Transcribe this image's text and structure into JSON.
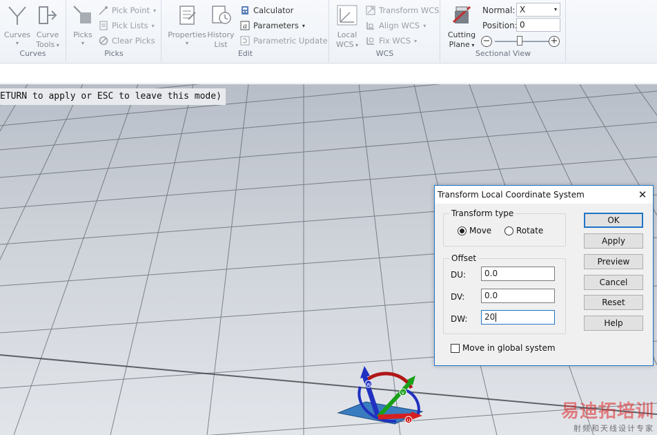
{
  "ribbon": {
    "curves_group": {
      "label": "Curves",
      "curves_button": "Curves",
      "curve_tools_button_line1": "Curve",
      "curve_tools_button_line2": "Tools"
    },
    "picks_group": {
      "label": "Picks",
      "picks_button": "Picks",
      "pick_point": "Pick Point",
      "pick_lists": "Pick Lists",
      "clear_picks": "Clear Picks"
    },
    "edit_group": {
      "label": "Edit",
      "properties_button": "Properties",
      "history_button_line1": "History",
      "history_button_line2": "List",
      "calculator": "Calculator",
      "parameters": "Parameters",
      "parametric_update": "Parametric Update"
    },
    "wcs_group": {
      "label": "WCS",
      "local_wcs_line1": "Local",
      "local_wcs_line2": "WCS",
      "transform_wcs": "Transform WCS",
      "align_wcs": "Align WCS",
      "fix_wcs": "Fix WCS"
    },
    "sectional_group": {
      "label": "Sectional View",
      "cutting_plane_line1": "Cutting",
      "cutting_plane_line2": "Plane",
      "normal_label": "Normal:",
      "normal_value": "X",
      "position_label": "Position:",
      "position_value": "0",
      "slider_minus": "−",
      "slider_plus": "+"
    }
  },
  "viewport": {
    "status_message": "ETURN to apply or ESC to leave this mode)",
    "background_top": "#b8bec8",
    "background_bottom": "#e2e5ea",
    "axes_labels": {
      "u": "u",
      "v": "v",
      "w": "w"
    },
    "colors": {
      "u_axis": "#d42020",
      "v_axis": "#18a018",
      "w_axis": "#2030c0",
      "plane": "#3a7cc0"
    }
  },
  "dialog": {
    "title": "Transform Local Coordinate System",
    "close_glyph": "✕",
    "transform_type": {
      "legend": "Transform type",
      "options": [
        "Move",
        "Rotate"
      ],
      "selected": "Move"
    },
    "offset": {
      "legend": "Offset",
      "du_label": "DU:",
      "du_value": "0.0",
      "dv_label": "DV:",
      "dv_value": "0.0",
      "dw_label": "DW:",
      "dw_value": "20"
    },
    "global_checkbox_label": "Move in global system",
    "buttons": {
      "ok": "OK",
      "apply": "Apply",
      "preview": "Preview",
      "cancel": "Cancel",
      "reset": "Reset",
      "help": "Help"
    }
  },
  "watermark": {
    "main": "易迪拓培训",
    "sub": "射频和天线设计专家"
  }
}
